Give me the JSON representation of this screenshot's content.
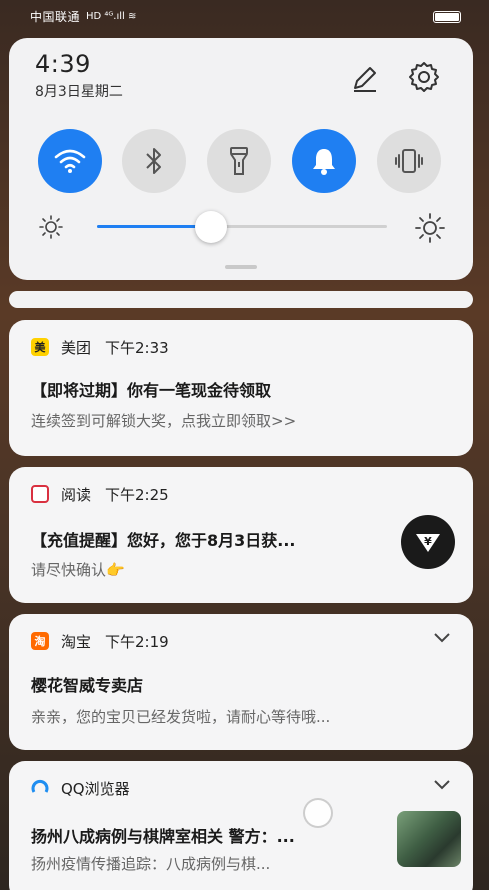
{
  "status_bar": {
    "carrier": "中国联通",
    "network": "HD ⁴ᴳ.ıll ≋"
  },
  "quick_settings": {
    "time": "4:39",
    "date": "8月3日星期二",
    "toggles": [
      {
        "name": "wifi-icon",
        "state": "on"
      },
      {
        "name": "bluetooth-icon",
        "state": "off"
      },
      {
        "name": "flashlight-icon",
        "state": "off"
      },
      {
        "name": "bell-icon",
        "state": "on"
      },
      {
        "name": "vibrate-icon",
        "state": "off"
      }
    ],
    "brightness_level": 0.37,
    "accent_color": "#1f7ff2"
  },
  "notifications": [
    {
      "app": "美团",
      "app_icon_char": "美",
      "time": "下午2:33",
      "title": "【即将过期】你有一笔现金待领取",
      "body": "连续签到可解锁大奖，点我立即领取>>"
    },
    {
      "app": "阅读",
      "time": "下午2:25",
      "title": "【充值提醒】您好，您于8月3日获...",
      "body": "请尽快确认👉",
      "badge_char": "¥"
    },
    {
      "app": "淘宝",
      "app_icon_char": "淘",
      "time": "下午2:19",
      "title": "樱花智威专卖店",
      "body": "亲亲，您的宝贝已经发货啦，请耐心等待哦..."
    },
    {
      "app": "QQ浏览器",
      "time": "",
      "title": "扬州八成病例与棋牌室相关 警方：...",
      "body": "扬州疫情传播追踪：八成病例与棋..."
    }
  ]
}
